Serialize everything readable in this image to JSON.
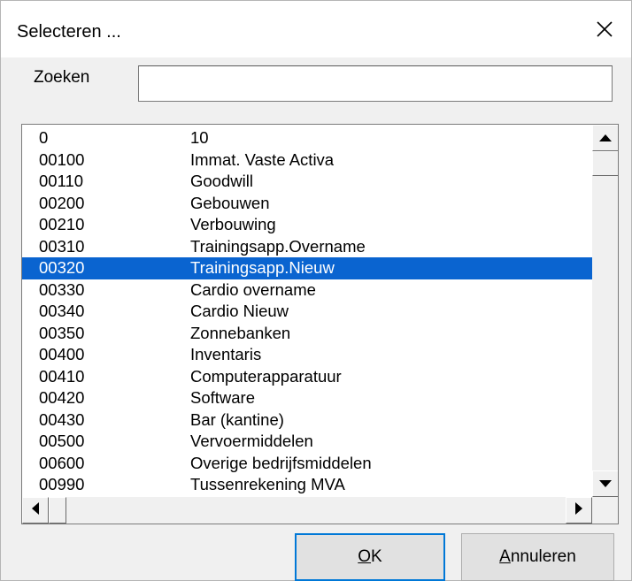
{
  "dialog": {
    "title": "Selecteren ..."
  },
  "icons": {
    "close": "close-icon",
    "scroll_up": "arrow-up-icon",
    "scroll_down": "arrow-down-icon",
    "scroll_left": "arrow-left-icon",
    "scroll_right": "arrow-right-icon"
  },
  "search": {
    "label": "Zoeken",
    "value": "",
    "placeholder": ""
  },
  "list": {
    "selected_index": 6,
    "rows": [
      {
        "code": "0",
        "description": "10"
      },
      {
        "code": "00100",
        "description": "Immat. Vaste Activa"
      },
      {
        "code": "00110",
        "description": "Goodwill"
      },
      {
        "code": "00200",
        "description": "Gebouwen"
      },
      {
        "code": "00210",
        "description": "Verbouwing"
      },
      {
        "code": "00310",
        "description": "Trainingsapp.Overname"
      },
      {
        "code": "00320",
        "description": "Trainingsapp.Nieuw"
      },
      {
        "code": "00330",
        "description": "Cardio overname"
      },
      {
        "code": "00340",
        "description": "Cardio Nieuw"
      },
      {
        "code": "00350",
        "description": "Zonnebanken"
      },
      {
        "code": "00400",
        "description": "Inventaris"
      },
      {
        "code": "00410",
        "description": "Computerapparatuur"
      },
      {
        "code": "00420",
        "description": "Software"
      },
      {
        "code": "00430",
        "description": "Bar (kantine)"
      },
      {
        "code": "00500",
        "description": "Vervoermiddelen"
      },
      {
        "code": "00600",
        "description": "Overige bedrijfsmiddelen"
      },
      {
        "code": "00990",
        "description": "Tussenrekening MVA"
      }
    ]
  },
  "buttons": {
    "ok_accel": "O",
    "ok_rest": "K",
    "cancel_accel": "A",
    "cancel_rest": "nnuleren"
  },
  "colors": {
    "selection": "#0a64d0",
    "focus_border": "#0078d7",
    "dialog_bg": "#f0f0f0"
  }
}
